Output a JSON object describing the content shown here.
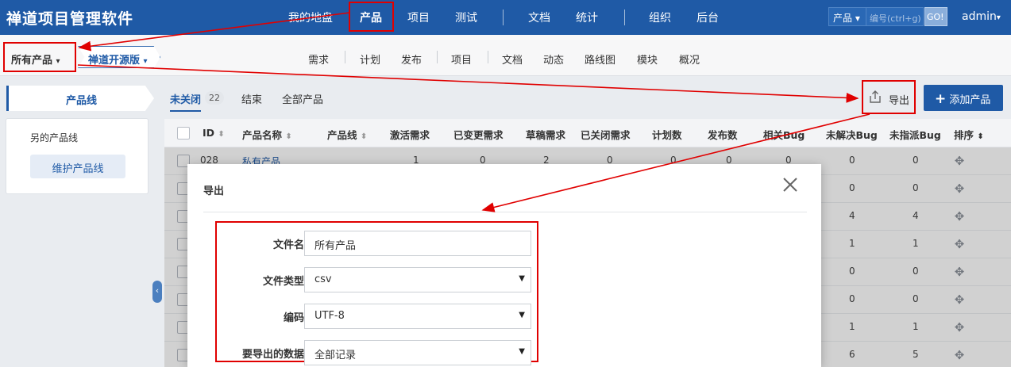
{
  "app": {
    "title": "禅道项目管理软件"
  },
  "main_nav": {
    "items": [
      "我的地盘",
      "产品",
      "项目",
      "测试",
      "文档",
      "统计",
      "组织",
      "后台"
    ],
    "active": "产品"
  },
  "topbar": {
    "product_select": "产品",
    "search_placeholder": "编号(ctrl+g)",
    "go_label": "GO!",
    "user": "admin"
  },
  "breadcrumb": {
    "product": "所有产品",
    "program": "禅道开源版"
  },
  "sub_nav": {
    "items": [
      "需求",
      "计划",
      "发布",
      "项目",
      "文档",
      "动态",
      "路线图",
      "模块",
      "概况"
    ]
  },
  "sidebar": {
    "tab": "产品线",
    "line_item": "另的产品线",
    "maintain_button": "维护产品线",
    "collapse_icon": "chevron-left-icon"
  },
  "filters": {
    "tabs": [
      "未关闭",
      "结束",
      "全部产品"
    ],
    "active": "未关闭",
    "open_count": "22"
  },
  "actions": {
    "export_label": "导出",
    "export_icon": "export-icon",
    "add_label": "添加产品",
    "add_icon": "plus-icon"
  },
  "table": {
    "columns": [
      "ID",
      "产品名称",
      "产品线",
      "激活需求",
      "已变更需求",
      "草稿需求",
      "已关闭需求",
      "计划数",
      "发布数",
      "相关Bug",
      "未解决Bug",
      "未指派Bug",
      "排序"
    ],
    "rows": [
      {
        "id": "028",
        "name": "私有产品",
        "active": "1",
        "changed": "0",
        "draft": "2",
        "closed": "0",
        "plans": "0",
        "releases": "0",
        "bugs": "0",
        "unresolved": "0",
        "unassigned": "0"
      },
      {
        "unresolved": "0",
        "unassigned": "0"
      },
      {
        "unresolved": "4",
        "unassigned": "4"
      },
      {
        "unresolved": "1",
        "unassigned": "1"
      },
      {
        "unresolved": "0",
        "unassigned": "0"
      },
      {
        "unresolved": "0",
        "unassigned": "0"
      },
      {
        "unresolved": "1",
        "unassigned": "1"
      },
      {
        "unresolved": "6",
        "unassigned": "5"
      }
    ]
  },
  "export_dialog": {
    "title": "导出",
    "close_icon": "close-icon",
    "fields": [
      {
        "label": "文件名",
        "value": "所有产品",
        "type": "input"
      },
      {
        "label": "文件类型",
        "value": "csv",
        "type": "select"
      },
      {
        "label": "编码",
        "value": "UTF-8",
        "type": "select"
      },
      {
        "label": "要导出的数据",
        "value": "全部记录",
        "type": "select"
      }
    ]
  },
  "annotation_color": "#e00000"
}
